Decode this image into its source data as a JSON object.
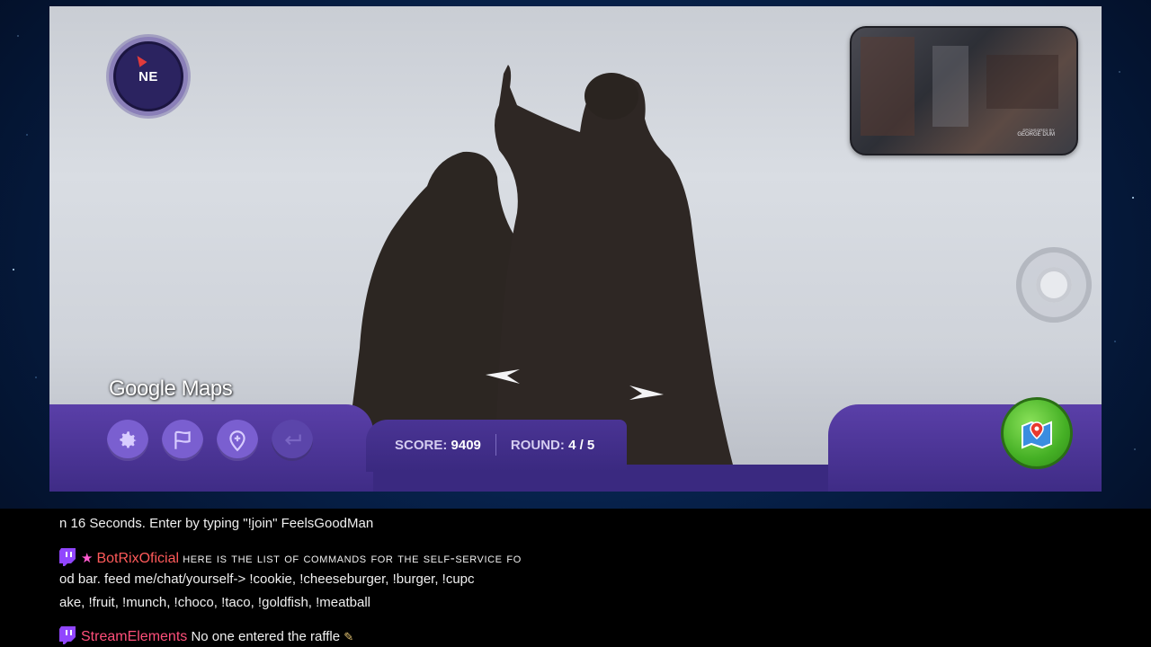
{
  "compass": {
    "direction": "NE"
  },
  "minimap": {
    "credit_small": "SPONSORED BY",
    "credit_name": "GEORGE DUM"
  },
  "brand": {
    "google": "Google",
    "maps": "Maps"
  },
  "controls": {
    "settings_icon": "gear-icon",
    "flag_icon": "flag-icon",
    "marker_icon": "location-pin-icon",
    "undo_icon": "return-arrow-icon"
  },
  "hud": {
    "score_label": "SCORE:",
    "score_value": "9409",
    "round_label": "ROUND:",
    "round_value": "4 / 5"
  },
  "chat": {
    "line1": "n 16 Seconds. Enter by typing \"!join\" FeelsGoodMan",
    "line2_user": "BotRixOficial",
    "line2_msg_a": "here is the list of commands for the self-service fo",
    "line2_msg_b": "od bar. feed me/chat/yourself-> !cookie, !cheeseburger, !burger, !cupc",
    "line2_msg_c": "ake, !fruit, !munch, !choco, !taco, !goldfish, !meatball",
    "line3_user": "StreamElements",
    "line3_msg": "No one entered the raffle"
  },
  "colors": {
    "hud_purple": "#5a3fa8",
    "button_purple": "#7a5fd0",
    "map_green": "#45b025",
    "username_red": "#ff5a5a"
  }
}
